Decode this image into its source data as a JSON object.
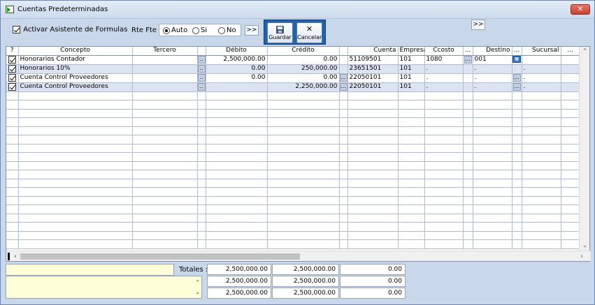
{
  "window": {
    "title": "Cuentas Predeterminadas",
    "close_label": "✕"
  },
  "toolbar": {
    "asistente_label": "Activar Asistente de Formulas",
    "rte_label": "Rte Fte",
    "rte_options": [
      "Auto",
      "Si",
      "No"
    ],
    "rte_selected": "Auto",
    "more_label": ">>",
    "more_right_label": ">>",
    "guardar_label": "Guardar",
    "cancelar_label": "Cancelar"
  },
  "grid": {
    "headers": [
      "?",
      "Concepto",
      "Tercero",
      "",
      "Débito",
      "Crédito",
      "",
      "Cuenta",
      "Empresa",
      "Ccosto",
      "...",
      "Destino",
      "...",
      "Sucursal",
      "..."
    ],
    "button_label": "..",
    "button_label_wide": "...",
    "icon_label": "▦",
    "rows": [
      {
        "checked": true,
        "concepto": "Honorarios Contador",
        "tercero": "",
        "debito": "2,500,000.00",
        "credito": "0.00",
        "cuenta": "51109501",
        "empresa": "101",
        "ccosto": "1080",
        "destino": "001",
        "sucursal": ""
      },
      {
        "checked": true,
        "concepto": "Honorarios 10%",
        "tercero": "",
        "debito": "0.00",
        "credito": "250,000.00",
        "cuenta": "23651501",
        "empresa": "101",
        "ccosto": ".",
        "destino": ".",
        "sucursal": "."
      },
      {
        "checked": true,
        "concepto": "Cuenta Control Proveedores",
        "tercero": "",
        "debito": "0.00",
        "credito": "0.00",
        "cuenta": "22050101",
        "empresa": "101",
        "ccosto": ".",
        "destino": ".",
        "sucursal": "."
      },
      {
        "checked": true,
        "concepto": "Cuenta Control Proveedores",
        "tercero": "",
        "debito": "",
        "credito": "2,250,000.00",
        "cuenta": "22050101",
        "empresa": "101",
        "ccosto": ".",
        "destino": ".",
        "sucursal": "."
      }
    ]
  },
  "totals": {
    "label": "Totales :",
    "rows": [
      [
        "2,500,000.00",
        "2,500,000.00",
        "0.00"
      ],
      [
        "2,500,000.00",
        "2,500,000.00",
        "0.00"
      ],
      [
        "2,500,000.00",
        "2,500,000.00",
        "0.00"
      ]
    ]
  }
}
